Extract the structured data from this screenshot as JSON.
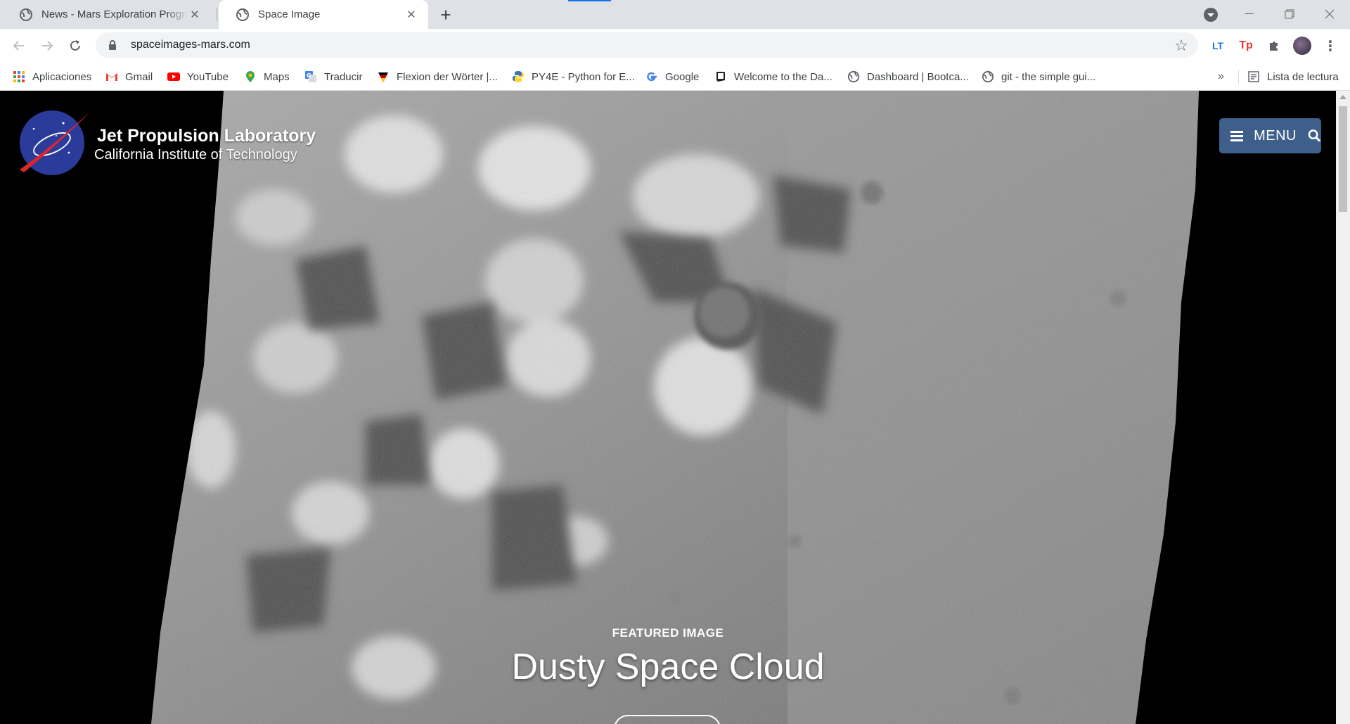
{
  "browser": {
    "tabs": [
      {
        "title": "News - Mars Exploration Program",
        "icon": "globe-icon",
        "active": false
      },
      {
        "title": "Space Image",
        "icon": "globe-icon",
        "active": true
      }
    ],
    "address": "spaceimages-mars.com",
    "extensions": {
      "lt": "LT",
      "tp": "Tp"
    }
  },
  "bookmarks": [
    {
      "label": "Aplicaciones",
      "icon": "apps-grid-icon"
    },
    {
      "label": "Gmail",
      "icon": "gmail-icon"
    },
    {
      "label": "YouTube",
      "icon": "youtube-icon"
    },
    {
      "label": "Maps",
      "icon": "maps-pin-icon"
    },
    {
      "label": "Traducir",
      "icon": "translate-icon"
    },
    {
      "label": "Flexion der Wörter |...",
      "icon": "flexion-icon"
    },
    {
      "label": "PY4E - Python for E...",
      "icon": "python-icon"
    },
    {
      "label": "Google",
      "icon": "google-icon"
    },
    {
      "label": "Welcome to the Da...",
      "icon": "book-icon"
    },
    {
      "label": "Dashboard | Bootca...",
      "icon": "globe-icon"
    },
    {
      "label": "git - the simple gui...",
      "icon": "globe-icon"
    }
  ],
  "bookmarks_more": "»",
  "reading_list": "Lista de lectura",
  "page": {
    "brand_name": "Jet Propulsion Laboratory",
    "brand_sub": "California Institute of Technology",
    "menu_label": "MENU",
    "featured_kicker": "FEATURED IMAGE",
    "featured_title": "Dusty Space Cloud"
  },
  "colors": {
    "menu_button": "#3f5f8b",
    "tabstrip": "#dee1e6",
    "accent": "#1a73e8"
  }
}
